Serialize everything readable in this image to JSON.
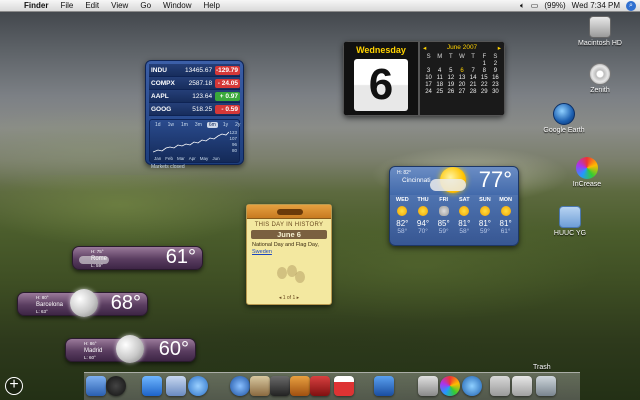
{
  "menubar": {
    "items": [
      "Finder",
      "File",
      "Edit",
      "View",
      "Go",
      "Window",
      "Help"
    ],
    "battery": "(99%)",
    "clock": "Wed 7:34 PM"
  },
  "desktop_icons": [
    {
      "label": "Macintosh HD"
    },
    {
      "label": "Zenith"
    },
    {
      "label": "Google Earth"
    },
    {
      "label": "InCrease"
    },
    {
      "label": "HUUC YG"
    }
  ],
  "stocks": {
    "rows": [
      {
        "symbol": "INDU",
        "price": "13465.67",
        "change": "-129.79",
        "dir": "down"
      },
      {
        "symbol": "COMPX",
        "price": "2587.18",
        "change": "- 24.05",
        "dir": "down"
      },
      {
        "symbol": "AAPL",
        "price": "123.64",
        "change": "+ 0.97",
        "dir": "up"
      },
      {
        "symbol": "GOOG",
        "price": "518.25",
        "change": "- 0.59",
        "dir": "down"
      }
    ],
    "ranges": [
      "1d",
      "1w",
      "1m",
      "3m",
      "6m",
      "1y",
      "2y"
    ],
    "active_range": "6m",
    "y_labels": [
      "123",
      "107",
      "96",
      "80"
    ],
    "x_labels": [
      "Jan",
      "Feb",
      "Mar",
      "Apr",
      "May",
      "Jun"
    ],
    "status": "Markets closed"
  },
  "calendar": {
    "weekday": "Wednesday",
    "date": "6",
    "month_title": "June 2007",
    "dow": [
      "S",
      "M",
      "T",
      "W",
      "T",
      "F",
      "S"
    ],
    "days": [
      "",
      "",
      "",
      "",
      "",
      "1",
      "2",
      "3",
      "4",
      "5",
      "6",
      "7",
      "8",
      "9",
      "10",
      "11",
      "12",
      "13",
      "14",
      "15",
      "16",
      "17",
      "18",
      "19",
      "20",
      "21",
      "22",
      "23",
      "24",
      "25",
      "26",
      "27",
      "28",
      "29",
      "30"
    ],
    "today": "6"
  },
  "weather_main": {
    "hilo": "H: 82°",
    "lo": "L: 63°",
    "city": "Cincinnati",
    "temp": "77°",
    "forecast": [
      {
        "day": "WED",
        "hi": "82°",
        "lo": "58°",
        "icon": "sun"
      },
      {
        "day": "THU",
        "hi": "94°",
        "lo": "70°",
        "icon": "sun"
      },
      {
        "day": "FRI",
        "hi": "85°",
        "lo": "59°",
        "icon": "storm"
      },
      {
        "day": "SAT",
        "hi": "81°",
        "lo": "58°",
        "icon": "sun"
      },
      {
        "day": "SUN",
        "hi": "81°",
        "lo": "59°",
        "icon": "sun"
      },
      {
        "day": "MON",
        "hi": "81°",
        "lo": "61°",
        "icon": "sun"
      }
    ]
  },
  "history": {
    "title": "THIS DAY IN HISTORY",
    "date": "June 6",
    "body": "National Day and Flag Day,",
    "link": "Sweden",
    "pager": "1 of 1"
  },
  "weather_small": [
    {
      "hi": "H: 75°",
      "city": "Rome",
      "lo": "L: 59°",
      "temp": "61°"
    },
    {
      "hi": "H: 80°",
      "city": "Barcelona",
      "lo": "L: 63°",
      "temp": "68°"
    },
    {
      "hi": "H: 86°",
      "city": "Madrid",
      "lo": "L: 60°",
      "temp": "60°"
    }
  ],
  "dock": {
    "trash_label": "Trash"
  },
  "colors": {
    "stock_down": "#d43838",
    "stock_up": "#3aa83a",
    "calendar_accent": "#ffd200"
  }
}
